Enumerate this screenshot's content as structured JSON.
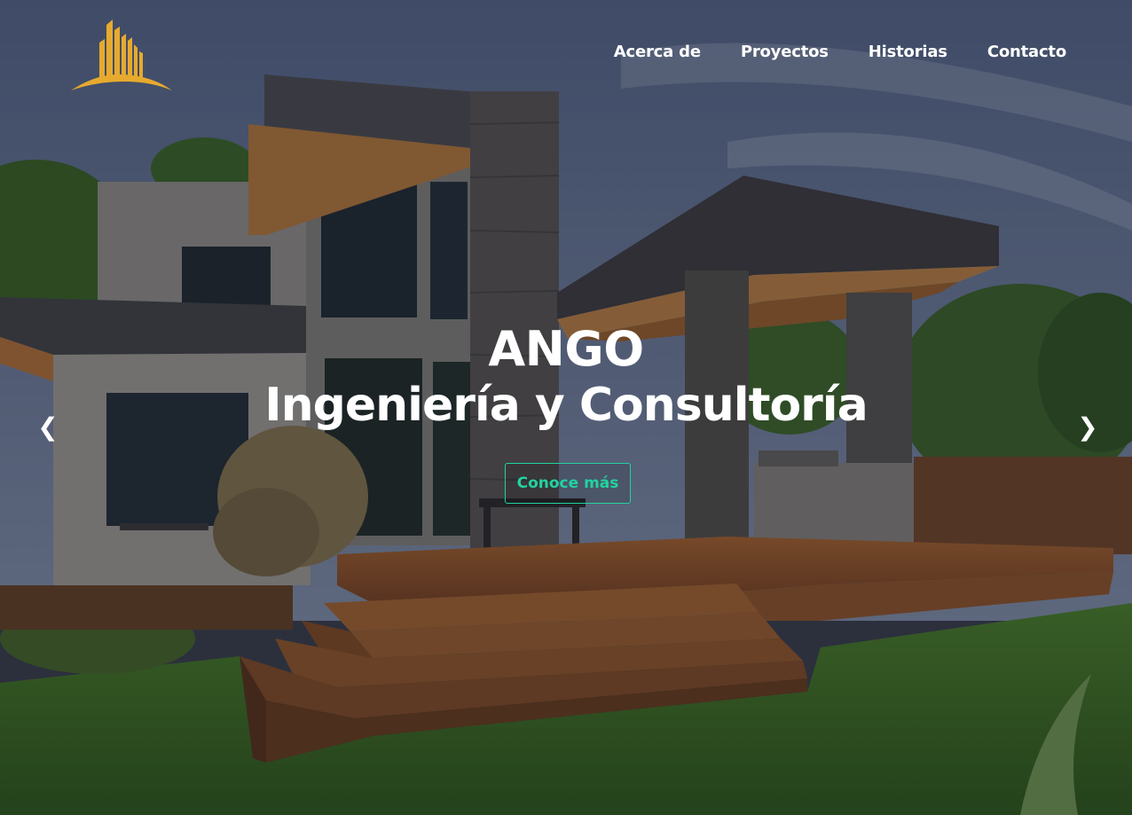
{
  "brand": {
    "logo_icon": "building-skyline-logo",
    "logo_color": "#e7aa2e"
  },
  "nav": {
    "items": [
      {
        "label": "Acerca de"
      },
      {
        "label": "Proyectos"
      },
      {
        "label": "Historias"
      },
      {
        "label": "Contacto"
      }
    ]
  },
  "hero": {
    "title_line1": "ANGO",
    "title_line2": "Ingeniería y Consultoría",
    "cta_label": "Conoce más",
    "cta_color": "#21d3a0",
    "prev_icon": "chevron-left-icon",
    "prev_glyph": "❮",
    "next_icon": "chevron-right-icon",
    "next_glyph": "❯"
  }
}
